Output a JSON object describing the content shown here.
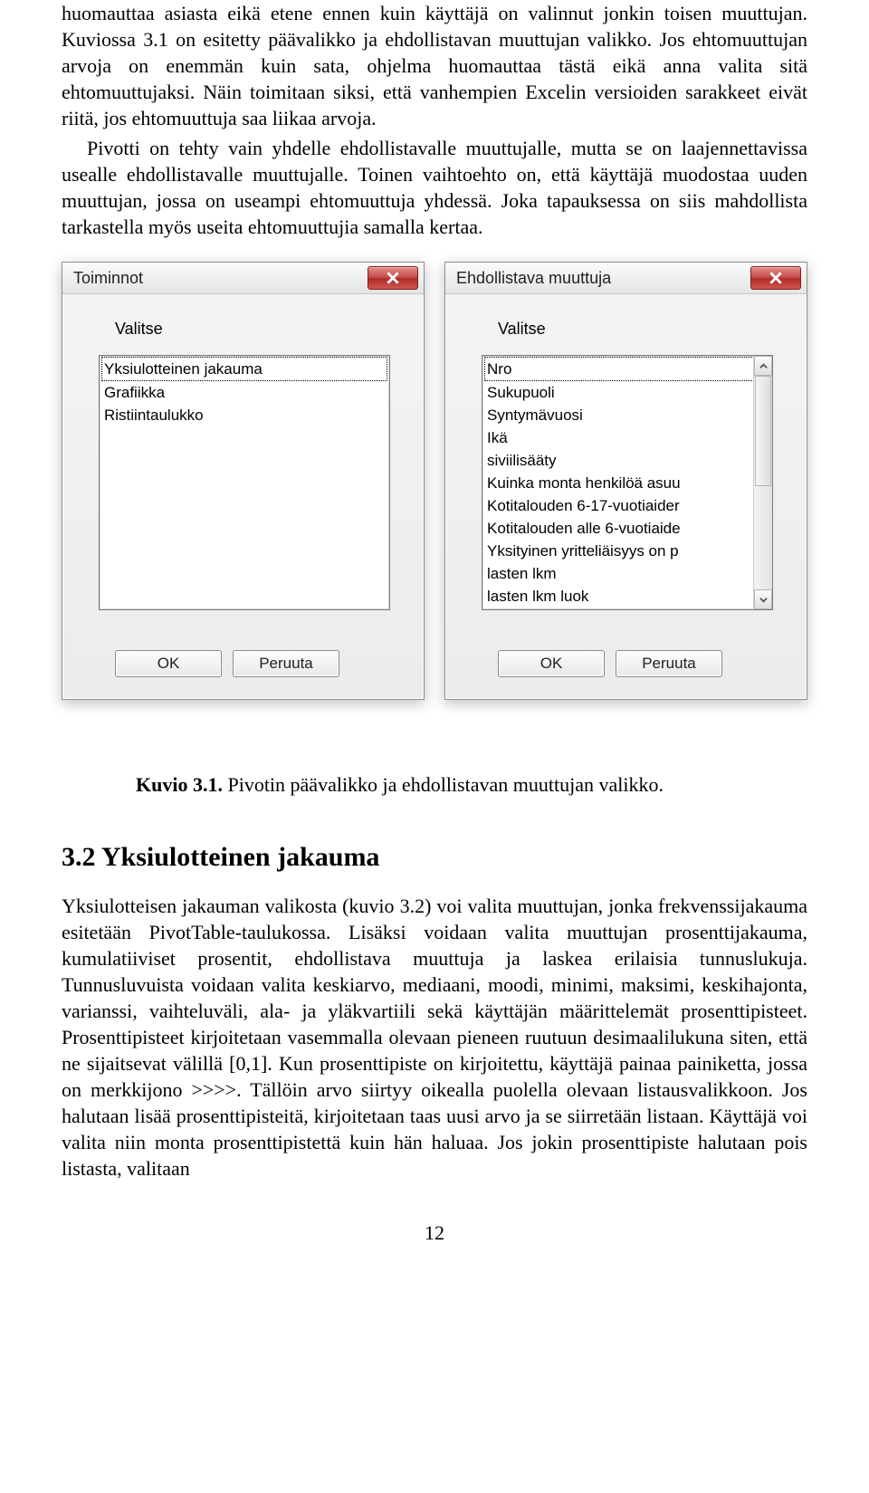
{
  "para1": "huomauttaa asiasta eikä etene ennen kuin käyttäjä on valinnut jonkin toisen muuttujan. Kuviossa 3.1 on esitetty päävalikko ja ehdollistavan muuttujan valikko. Jos ehtomuuttujan arvoja on enemmän kuin sata, ohjelma huomauttaa tästä eikä anna valita sitä ehtomuuttujaksi. Näin toimitaan siksi, että vanhempien Excelin versioiden sarakkeet eivät riitä, jos ehtomuuttuja saa liikaa arvoja.",
  "para2": "Pivotti on tehty vain yhdelle ehdollistavalle muuttujalle, mutta se on laajennettavissa usealle ehdollistavalle muuttujalle. Toinen vaihtoehto on, että käyttäjä muodostaa uuden muuttujan, jossa on useampi ehtomuuttuja yhdessä. Joka tapauksessa on siis mahdollista tarkastella myös useita ehtomuuttujia samalla kertaa.",
  "dlg1": {
    "title": "Toiminnot",
    "select_label": "Valitse",
    "items": [
      "Yksiulotteinen jakauma",
      "Grafiikka",
      "Ristiintaulukko"
    ],
    "ok": "OK",
    "cancel": "Peruuta"
  },
  "dlg2": {
    "title": "Ehdollistava muuttuja",
    "select_label": "Valitse",
    "items": [
      "Nro",
      "Sukupuoli",
      "Syntymävuosi",
      "Ikä",
      "siviilisääty",
      "Kuinka monta henkilöä asuu",
      "Kotitalouden 6-17-vuotiaider",
      "Kotitalouden alle 6-vuotiaide",
      "Yksityinen yritteliäisyys on p",
      "lasten lkm",
      "lasten lkm luok"
    ],
    "ok": "OK",
    "cancel": "Peruuta"
  },
  "caption_bold": "Kuvio 3.1.",
  "caption_rest": " Pivotin päävalikko ja ehdollistavan muuttujan valikko.",
  "h2": "3.2   Yksiulotteinen jakauma",
  "para3": "Yksiulotteisen jakauman valikosta (kuvio 3.2) voi valita muuttujan, jonka frekvenssijakauma esitetään PivotTable-taulukossa. Lisäksi voidaan valita muuttujan prosenttijakauma, kumulatiiviset prosentit, ehdollistava muuttuja ja laskea erilaisia tunnuslukuja. Tunnusluvuista voidaan valita keskiarvo, mediaani, moodi, minimi, maksimi, keskihajonta, varianssi, vaihteluväli, ala- ja yläkvartiili sekä käyttäjän määrittelemät prosenttipisteet. Prosenttipisteet kirjoitetaan vasemmalla olevaan pieneen ruutuun desimaalilukuna siten, että ne sijaitsevat välillä [0,1]. Kun prosenttipiste on kirjoitettu, käyttäjä painaa painiketta, jossa on merkkijono >>>>. Tällöin arvo siirtyy oikealla puolella olevaan listausvalikkoon. Jos halutaan lisää prosenttipisteitä, kirjoitetaan taas uusi arvo ja se siirretään listaan. Käyttäjä voi valita niin monta prosenttipistettä kuin hän haluaa. Jos jokin prosenttipiste halutaan pois listasta, valitaan",
  "pagenum": "12"
}
